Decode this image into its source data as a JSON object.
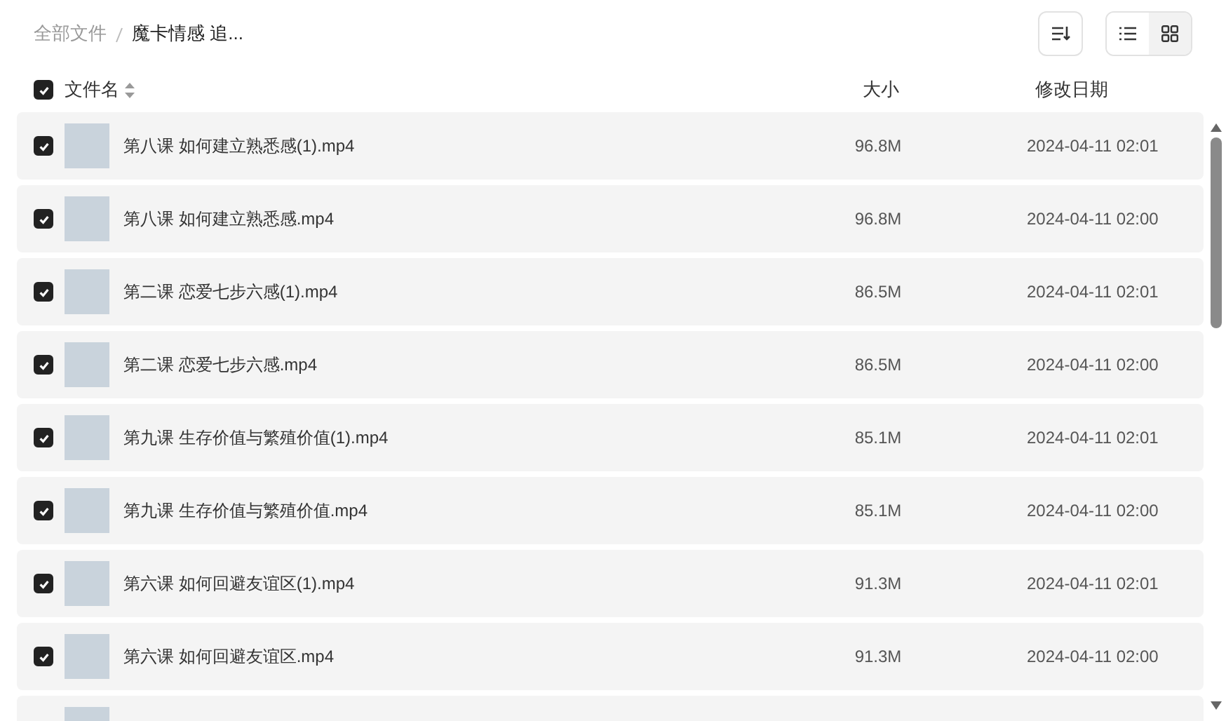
{
  "breadcrumb": [
    {
      "label": "全部文件",
      "current": false
    },
    {
      "label": "魔卡情感 追...",
      "current": true
    }
  ],
  "view_modes": [
    {
      "kind": "list",
      "selected": false
    },
    {
      "kind": "grid",
      "selected": true
    }
  ],
  "header": {
    "select_all": true,
    "name": "文件名",
    "size": "大小",
    "date": "修改日期"
  },
  "files": [
    {
      "checked": true,
      "name": "第八课 如何建立熟悉感(1).mp4",
      "size": "96.8M",
      "date": "2024-04-11 02:01"
    },
    {
      "checked": true,
      "name": "第八课 如何建立熟悉感.mp4",
      "size": "96.8M",
      "date": "2024-04-11 02:00"
    },
    {
      "checked": true,
      "name": "第二课 恋爱七步六感(1).mp4",
      "size": "86.5M",
      "date": "2024-04-11 02:01"
    },
    {
      "checked": true,
      "name": "第二课 恋爱七步六感.mp4",
      "size": "86.5M",
      "date": "2024-04-11 02:00"
    },
    {
      "checked": true,
      "name": "第九课 生存价值与繁殖价值(1).mp4",
      "size": "85.1M",
      "date": "2024-04-11 02:01"
    },
    {
      "checked": true,
      "name": "第九课 生存价值与繁殖价值.mp4",
      "size": "85.1M",
      "date": "2024-04-11 02:00"
    },
    {
      "checked": true,
      "name": "第六课 如何回避友谊区(1).mp4",
      "size": "91.3M",
      "date": "2024-04-11 02:01"
    },
    {
      "checked": true,
      "name": "第六课 如何回避友谊区.mp4",
      "size": "91.3M",
      "date": "2024-04-11 02:00"
    }
  ],
  "more_row_below": true
}
